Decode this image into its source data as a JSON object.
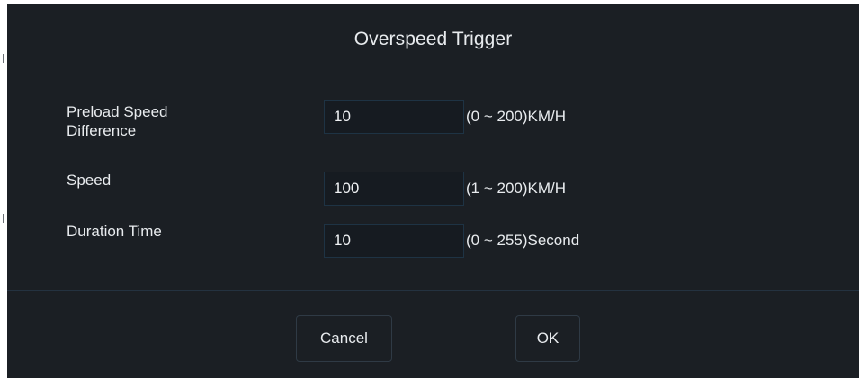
{
  "dialog": {
    "title": "Overspeed Trigger"
  },
  "form": {
    "rows": [
      {
        "label_line1": "Preload Speed",
        "label_line2": "Difference",
        "value": "10",
        "range": "(0 ~ 200)KM/H"
      },
      {
        "label": "Speed",
        "value": "100",
        "range": "(1 ~ 200)KM/H"
      },
      {
        "label": "Duration Time",
        "value": "10",
        "range": "(0 ~ 255)Second"
      }
    ]
  },
  "footer": {
    "cancel_label": "Cancel",
    "ok_label": "OK"
  },
  "colors": {
    "dialog_background": "#1b1f24",
    "field_background": "#161b21",
    "field_border": "#1e3344",
    "divider": "#243240",
    "text": "#e8ebee"
  }
}
